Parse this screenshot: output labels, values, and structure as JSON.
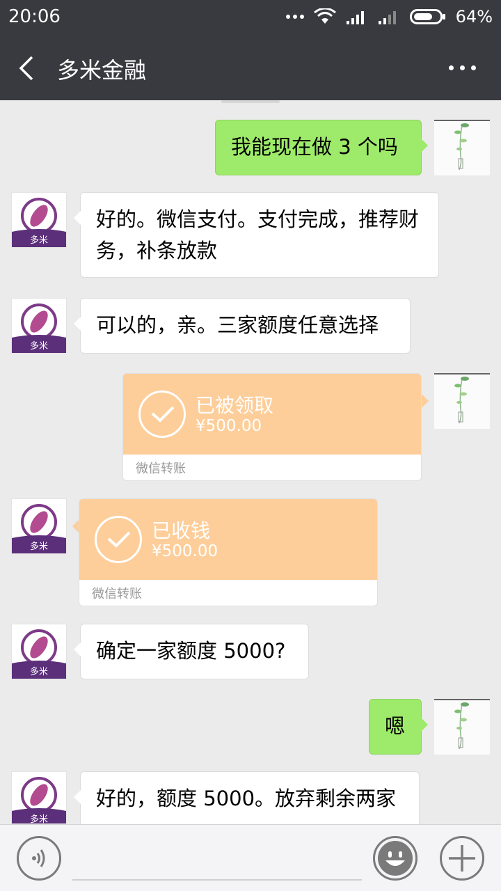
{
  "status_bar": {
    "time": "20:06",
    "battery": "64%"
  },
  "header": {
    "title": "多米金融"
  },
  "messages": [
    {
      "side": "out",
      "text": "我能现在做 3 个吗"
    },
    {
      "side": "in",
      "text_lines": [
        "好的。微信支付。支付完成，推荐财",
        "务，补条放款"
      ]
    },
    {
      "side": "in",
      "text": "可以的，亲。三家额度任意选择"
    },
    {
      "side": "out",
      "type": "transfer",
      "status": "已被领取",
      "amount": "¥500.00",
      "label": "微信转账"
    },
    {
      "side": "in",
      "type": "transfer",
      "status": "已收钱",
      "amount": "¥500.00",
      "label": "微信转账"
    },
    {
      "side": "in",
      "text": "确定一家额度 5000?"
    },
    {
      "side": "out",
      "text": "嗯"
    },
    {
      "side": "in",
      "text": "好的，额度 5000。放弃剩余两家"
    }
  ],
  "avatar": {
    "brand_text": "多米"
  },
  "colors": {
    "bar": "#393a3f",
    "out_bubble": "#9eea6a",
    "transfer": "#fdce9a",
    "chat_bg": "#ebebeb"
  }
}
